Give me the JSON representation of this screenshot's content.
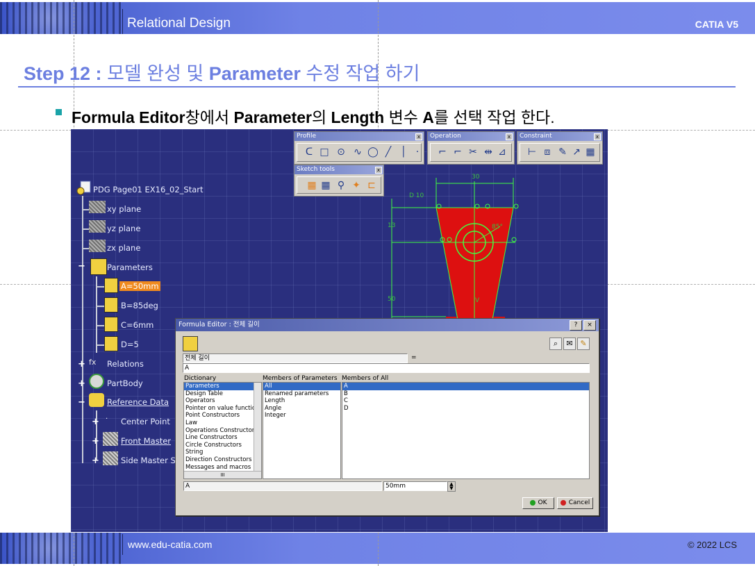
{
  "header": {
    "title": "Relational Design",
    "product": "CATIA V5"
  },
  "footer": {
    "website": "www.edu-catia.com",
    "copyright": "© 2022 LCS"
  },
  "slide": {
    "step_label": "Step 12 :",
    "step_title_ko_1": "모델 완성 및",
    "step_title_en": "Parameter",
    "step_title_ko_2": "수정 작업 하기",
    "bullet": {
      "b1": "Formula Editor",
      "n1": "창에서",
      "b2": "Parameter",
      "n2": "의",
      "b3": "Length",
      "n3": "변수",
      "b4": "A",
      "n4": "를 선택 작업 한다."
    }
  },
  "toolbars": {
    "profile": "Profile",
    "operation": "Operation",
    "constraint": "Constraint",
    "sketch_tools": "Sketch tools"
  },
  "tree": {
    "root": "PDG Page01 EX16_02_Start",
    "xy": "xy plane",
    "yz": "yz plane",
    "zx": "zx plane",
    "parameters": "Parameters",
    "param_a": "A=50mm",
    "param_b": "B=85deg",
    "param_c": "C=6mm",
    "param_d": "D=5",
    "relations": "Relations",
    "partbody": "PartBody",
    "reference_data": "Reference Data",
    "center_point": "Center Point",
    "front_master": "Front Master",
    "side_master": "Side Master S"
  },
  "sketch": {
    "dim_30": "30",
    "dim_d10": "D 10",
    "dim_13": "13",
    "dim_85": "85°",
    "dim_50": "50",
    "dim_v": "V"
  },
  "formula_editor": {
    "title": "Formula Editor : 전체 길이",
    "param_name": "전체 길이",
    "equals": "=",
    "formula": "A",
    "dictionary_label": "Dictionary",
    "members_params_label": "Members of Parameters",
    "members_all_label": "Members of All",
    "dictionary": [
      "Parameters",
      "Design Table",
      "Operators",
      "Pointer on value function",
      "Point Constructors",
      "Law",
      "Operations Constructors",
      "Line Constructors",
      "Circle Constructors",
      "String",
      "Direction Constructors",
      "Messages and macros"
    ],
    "members_params": [
      "All",
      "Renamed parameters",
      "Length",
      "Angle",
      "Integer"
    ],
    "members_all": [
      "A",
      "B",
      "C",
      "D"
    ],
    "selected_name": "A",
    "selected_value": "50mm",
    "ok": "OK",
    "cancel": "Cancel",
    "scroll_mark": "III"
  }
}
